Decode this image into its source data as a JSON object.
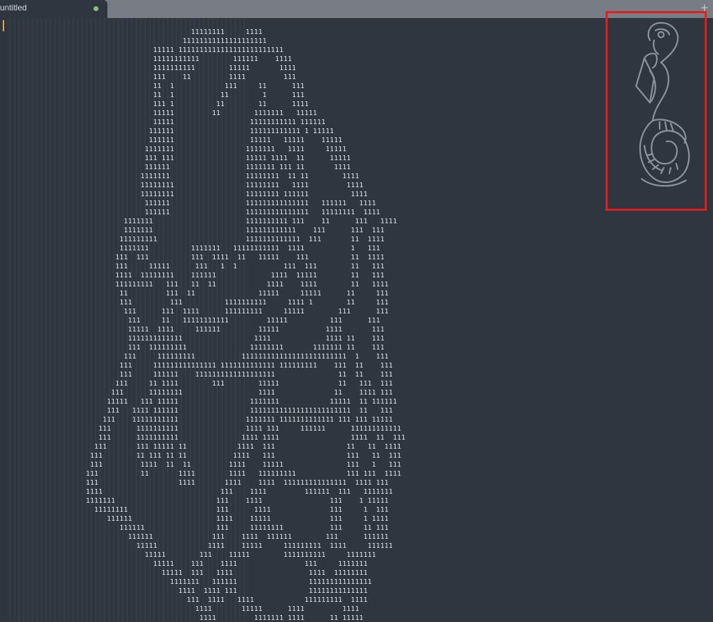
{
  "tab": {
    "title": "untitled",
    "dirty_indicator_color": "#8fbf7f"
  },
  "tabbar": {
    "new_tab_label": "+"
  },
  "editor": {
    "lines": [
      "                         11111111     1111",
      "                       11111111111111111111",
      "                11111 1111111111111111111111111",
      "                11111111111        111111    1111",
      "                1111111111        11111       1111",
      "                111    11         1111         111",
      "                11  1            111     11      111",
      "                11  1           11        1      111",
      "                111 1          11        11      1111",
      "                11111         11        1111111   11111",
      "                11111                  11111111111 111111",
      "               111111                  111111111111 1 11111",
      "               111111                  11111   11111    11111",
      "              1111111                 1111111   1111     11111",
      "              111 111                 11111 1111  11      11111",
      "              111111                  1111111 111 11       1111",
      "             1111111                  11111111  11 11        1111",
      "             11111111                 11111111   1111         1111",
      "             11111111                 11111111 111111          1111",
      "              111111                  111111111111111   111111   1111",
      "              111111                  111111111111111   11111111  1111",
      "         1111111                      1111111111 111    11      111   1111",
      "         1111111                      111111111111    111      111  111",
      "        111111111                     1111111111111  111       11  1111",
      "        1111111          1111111   11111111111  1111           1   111",
      "       111  111          111  1111  11   11111    111          11  1111",
      "       111     11111      111   1  1           111  111        11   111",
      "       1111  11111111    111111             1111  11111        11   111",
      "       111111111   111   11  11            1111    1111        11   1111",
      "        11         111  11               11111     11111      11     111",
      "        111         111          1111111111     1111 1        11     111",
      "         111      111  1111      111111111     11111        111      111",
      "          111     11   11111111111         11111          111      111",
      "          11111  1111     111111         11111           1111       111",
      "          1111111111111                 1111             1111 11    111",
      "          111  111111111               11111111       1111111 11    111",
      "         111     111111111           1111111111111111111111111  1    111",
      "        111     111111111111111 1111111111111 111111111    111  11    111",
      "        111     111111    1111111111111111111               11  11    111",
      "       111     11 1111        111        11111              11   111  111",
      "      111      11111111                  1111              11    1111 111",
      "     11111   111 11111                 1111111            11111  11 111111",
      "     111   1111 111111                 111111111111111111111111  11   111",
      "    111    11111111111                1111111 1111111111111 111 111 11111",
      "   111      1111111111                1111 111     111111      111111111111",
      "   111      1111111111               1111 1111                 1111  11  111",
      "  111       111 11111 11            1111  111                 11   11  1111",
      " 111        11 111 11 11           1111   111                 111   11  111",
      " 111         1111  11  11         1111    11111               111   1   111",
      "111          11       1111        1111   111111111            111 111  1111",
      "111                   1111       1111    1111  111111111111111  1111 111",
      "1111                            111    1111         111111  111   1111111",
      "1111111                        111    1111                111    1 11111",
      "  11111111                     111      1111              111     1  111",
      "     111111                    1111    11111              111     1 1111",
      "        111111                 111     11111111           111     11 111",
      "          111111              111    1111  111111        111      111111",
      "            11111            1111    11111     111111111  1111     111111",
      "              11111        111    11111        1111111111     1111111",
      "                11111    111    1111                111     1111111",
      "                  11111  111   1111                  1111  11111111",
      "                    1111111   111111                 111111111111111",
      "                      1111  1111 111                 11111111111111",
      "                        111  1111   1111            111111111  1111",
      "                          1111       11111      1111         1111",
      "                           1111         1111111 1111      11 11111"
    ]
  },
  "colors": {
    "background": "#2f3640",
    "tabbar": "#787c84",
    "text": "#e8ebf0",
    "cursor": "#e8a840",
    "highlight_border": "#e02020",
    "minimap_art": "#8e939b"
  },
  "minimap": {
    "icon": "snake-minimap-icon"
  }
}
